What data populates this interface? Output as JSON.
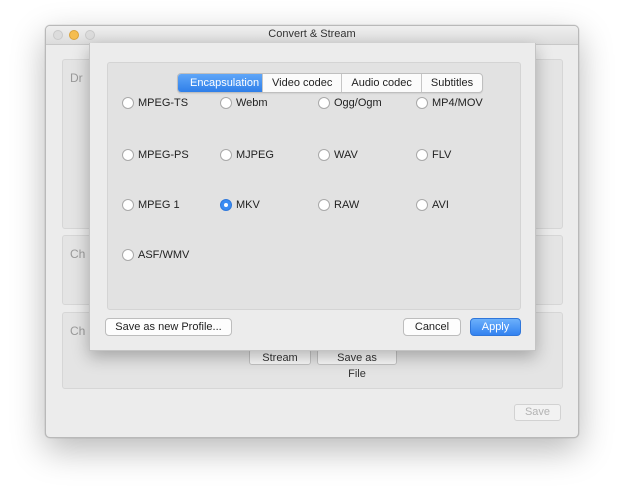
{
  "window": {
    "title": "Convert & Stream"
  },
  "background": {
    "panels": [
      "Dr",
      "Ch",
      "Ch"
    ],
    "stream_button": "Stream",
    "save_as_file_button": "Save as File",
    "save_button": "Save"
  },
  "dialog": {
    "tabs": [
      "Encapsulation",
      "Video codec",
      "Audio codec",
      "Subtitles"
    ],
    "active_tab": "Encapsulation",
    "options": [
      "MPEG-TS",
      "Webm",
      "Ogg/Ogm",
      "MP4/MOV",
      "MPEG-PS",
      "MJPEG",
      "WAV",
      "FLV",
      "MPEG 1",
      "MKV",
      "RAW",
      "AVI",
      "ASF/WMV"
    ],
    "selected_option": "MKV",
    "save_profile_button": "Save as new Profile...",
    "cancel_button": "Cancel",
    "apply_button": "Apply"
  },
  "colors": {
    "accent": "#3b8cf2"
  }
}
